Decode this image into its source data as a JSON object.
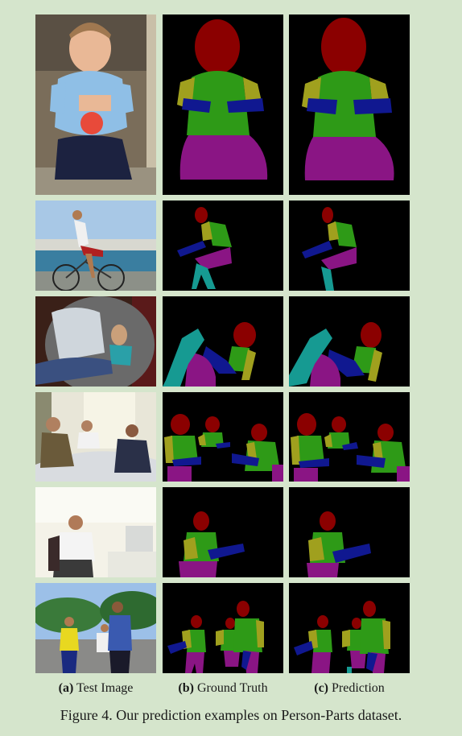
{
  "columns": [
    {
      "letter": "(a)",
      "label": "Test Image"
    },
    {
      "letter": "(b)",
      "label": "Ground Truth"
    },
    {
      "letter": "(c)",
      "label": "Prediction"
    }
  ],
  "caption": "Figure 4. Our prediction examples on Person-Parts dataset.",
  "part_colors": {
    "head": "#8b0000",
    "torso": "#2e9a17",
    "upper_arm": "#a0a01e",
    "lower_arm": "#101890",
    "upper_leg": "#8a1584",
    "lower_leg": "#169a92",
    "background": "#000000"
  }
}
